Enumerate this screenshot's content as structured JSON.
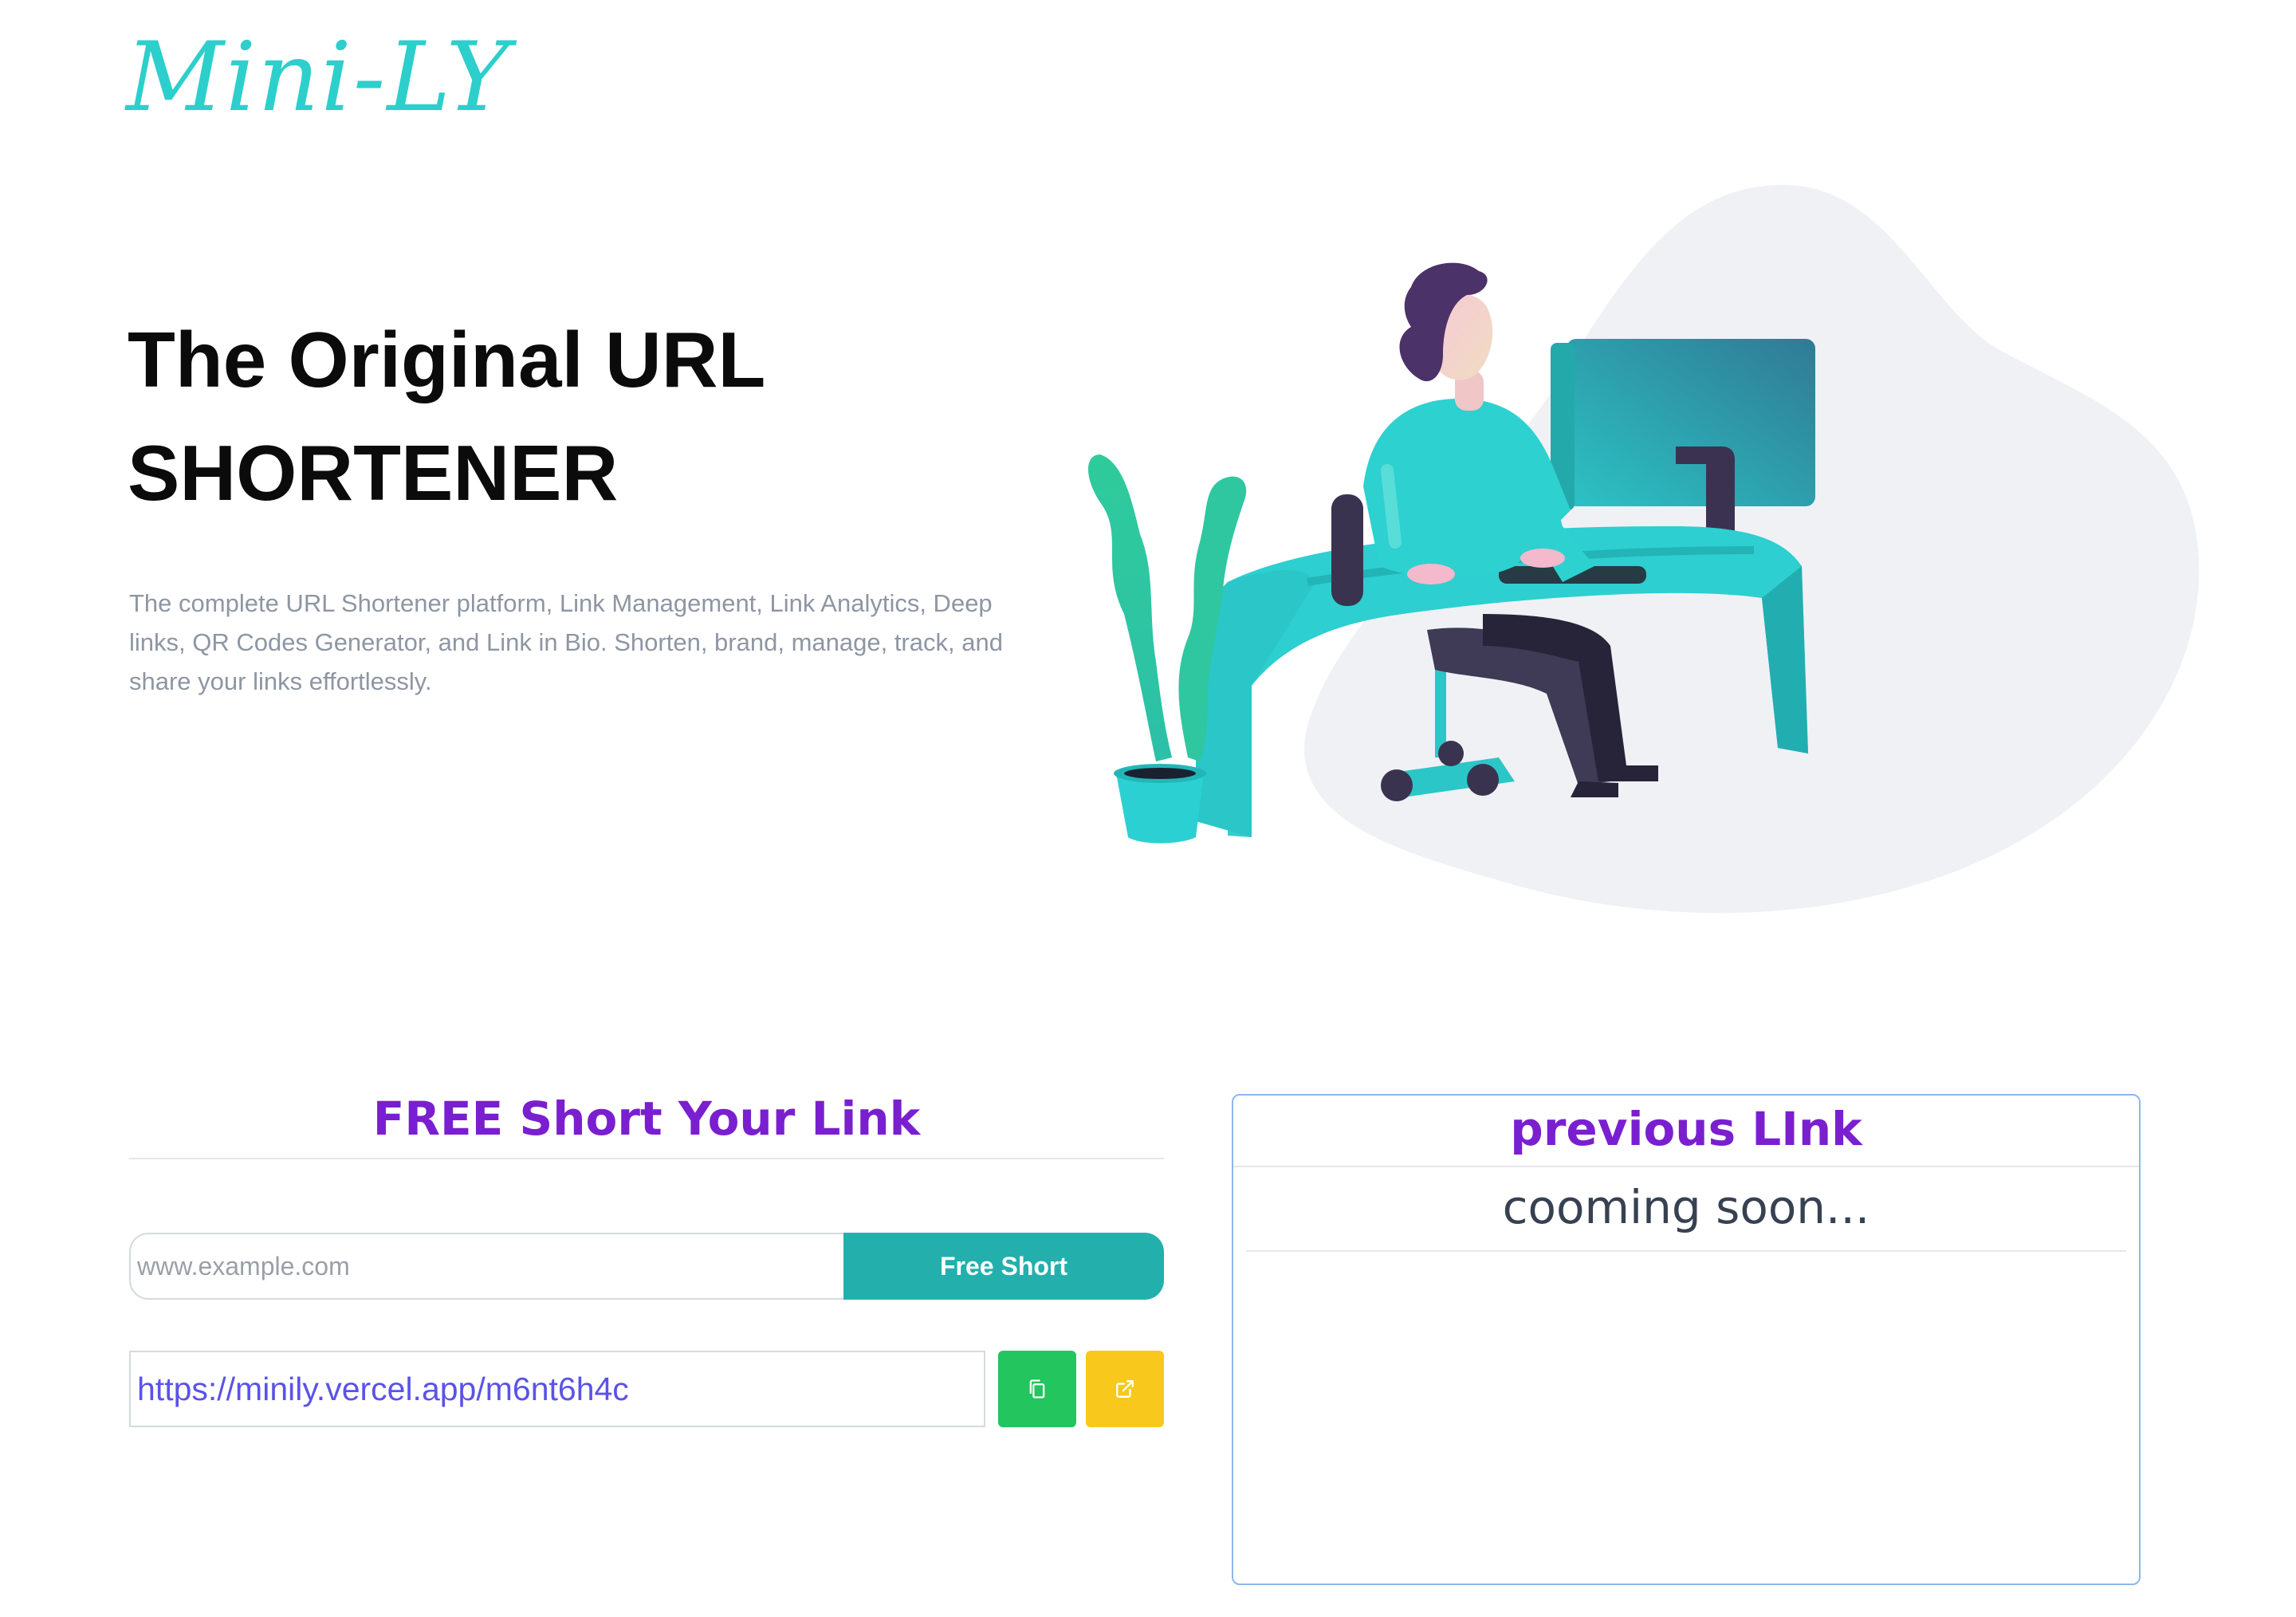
{
  "brand": {
    "logo_text": "Mini-LY",
    "logo_color": "#2ccfcb"
  },
  "hero": {
    "title_line1": "The Original URL",
    "title_line2": "SHORTENER",
    "description": "The complete URL Shortener platform, Link Management, Link Analytics, Deep links, QR Codes Generator, and Link in Bio. Shorten, brand, manage, track, and share your links effortlessly."
  },
  "shortener": {
    "heading": "FREE Short Your Link",
    "input_placeholder": "www.example.com",
    "input_value": "",
    "button_label": "Free Short",
    "result_link": "https://minily.vercel.app/m6nt6h4c",
    "copy_icon": "copy-icon",
    "open_icon": "external-link-icon"
  },
  "previous": {
    "heading": "previous LInk",
    "status": "cooming soon..."
  },
  "colors": {
    "accent_purple": "#7a1fd0",
    "teal_button": "#23b0ad",
    "copy_green": "#22c55e",
    "open_yellow": "#f8c81c",
    "link_blue": "#5b53e6",
    "panel_border": "#8fb6ee"
  }
}
